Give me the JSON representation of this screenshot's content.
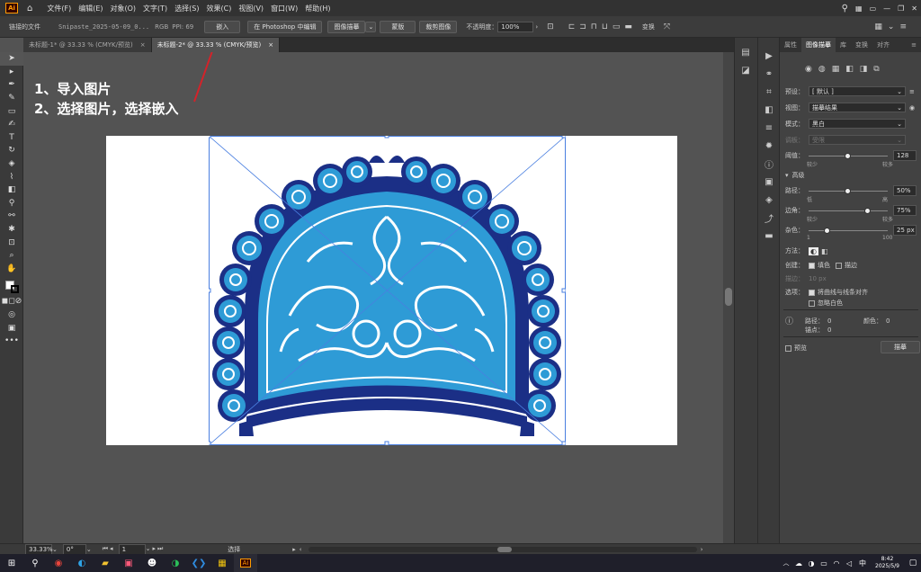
{
  "app": {
    "logo": "Ai"
  },
  "menu": [
    "文件(F)",
    "编辑(E)",
    "对象(O)",
    "文字(T)",
    "选择(S)",
    "效果(C)",
    "视图(V)",
    "窗口(W)",
    "帮助(H)"
  ],
  "control_bar": {
    "linked_file": "链接的文件",
    "filename": "Snipaste_2025-05-09_0...",
    "color_mode": "RGB",
    "ppi": "PPI: 69",
    "embed": "嵌入",
    "edit_in_ps": "在 Photoshop 中编辑",
    "image_trace": "图像描摹",
    "mask": "蒙版",
    "crop": "裁剪图像",
    "opacity_label": "不透明度：",
    "opacity_value": "100%",
    "transform": "变换"
  },
  "doc_tabs": [
    {
      "label": "未标题-1* @ 33.33 % (CMYK/预览)",
      "close": "×"
    },
    {
      "label": "未标题-2* @ 33.33 % (CMYK/预览)",
      "close": "×"
    }
  ],
  "instructions": [
    "1、导入图片",
    "2、选择图片，选择嵌入"
  ],
  "panel": {
    "tabs": [
      "属性",
      "图像描摹",
      "库",
      "变换",
      "对齐"
    ],
    "preset_label": "预设：",
    "preset_value": "[ 默认 ]",
    "view_label": "视图：",
    "view_value": "描摹结果",
    "mode_label": "模式：",
    "mode_value": "黑白",
    "palette_label": "调板：",
    "palette_value": "受限",
    "threshold_label": "阈值：",
    "threshold_value": "128",
    "threshold_min": "较少",
    "threshold_max": "较多",
    "threshold_level": 0.5,
    "advanced": "高级",
    "paths_label": "路径：",
    "paths_value": "50%",
    "paths_min": "低",
    "paths_max": "高",
    "paths_level": 0.5,
    "corners_label": "边角：",
    "corners_value": "75%",
    "corners_min": "较少",
    "corners_max": "较多",
    "corners_level": 0.75,
    "noise_label": "杂色：",
    "noise_value": "25 px",
    "noise_min": "1",
    "noise_max": "100",
    "noise_level": 0.24,
    "method_label": "方法：",
    "create_label": "创建：",
    "fill_label": "填色",
    "stroke_label": "描边",
    "strokes_label": "描边：",
    "strokes_value": "10 px",
    "options_label": "选项：",
    "snap_label": "将曲线与线条对齐",
    "ignore_white_label": "忽略白色",
    "paths_count_label": "路径：",
    "paths_count": "0",
    "colors_count_label": "颜色：",
    "colors_count": "0",
    "anchors_label": "锚点：",
    "anchors_count": "0",
    "preview_label": "预览",
    "trace_button": "描摹"
  },
  "status": {
    "zoom": "33.33%",
    "rotation": "0°",
    "artboard": "1",
    "tool": "选择"
  },
  "taskbar": {
    "time": "8:42",
    "date": "2025/5/9",
    "ime": "中"
  },
  "colors": {
    "ornament_light": "#2e9bd6",
    "ornament_dark": "#1b2f86",
    "selection": "#4a7fe0",
    "arrow": "#d2232a"
  }
}
